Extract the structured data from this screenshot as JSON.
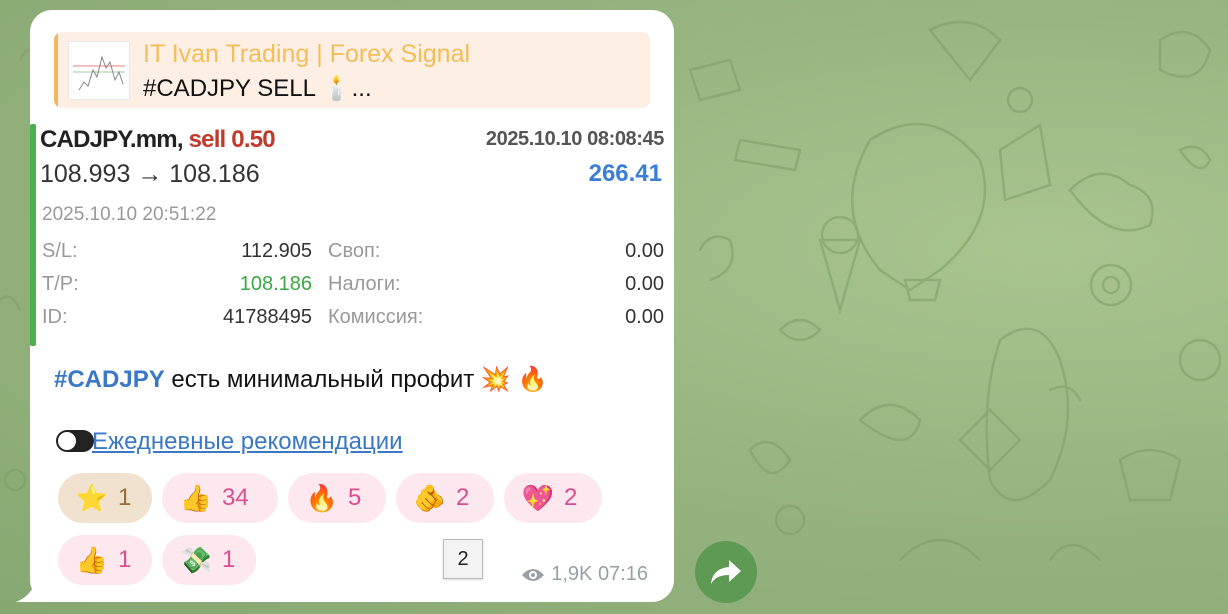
{
  "reply": {
    "channel": "IT Ivan Trading | Forex Signal",
    "preview": "#CADJPY SELL 🕯️..."
  },
  "trade": {
    "symbol": "CADJPY.mm,",
    "side": "sell 0.50",
    "open_time": "2025.10.10 08:08:45",
    "prices": "108.993 → 108.186",
    "profit": "266.41",
    "close_time": "2025.10.10 20:51:22",
    "sl_label": "S/L:",
    "sl_value": "112.905",
    "tp_label": "T/P:",
    "tp_value": "108.186",
    "id_label": "ID:",
    "id_value": "41788495",
    "swap_label": "Своп:",
    "swap_value": "0.00",
    "tax_label": "Налоги:",
    "tax_value": "0.00",
    "fee_label": "Комиссия:",
    "fee_value": "0.00"
  },
  "message": {
    "hashtag": "#CADJPY",
    "text": " есть минимальный профит ",
    "emoji": "💥 🔥",
    "link": "Ежедневные рекомендации"
  },
  "reactions": [
    {
      "icon": "⭐",
      "count": "1"
    },
    {
      "icon": "👍",
      "count": "34"
    },
    {
      "icon": "🔥",
      "count": "5"
    },
    {
      "icon": "🫵",
      "count": "2"
    },
    {
      "icon": "💖",
      "count": "2"
    },
    {
      "icon": "👍",
      "count": "1"
    },
    {
      "icon": "💸",
      "count": "1"
    }
  ],
  "meta": {
    "views": "1,9K",
    "time": "07:16"
  },
  "pager": "2",
  "colors": {
    "accent": "#3a78c5",
    "sell": "#c0392b",
    "profit": "#3a7fd5",
    "tp": "#3aa844",
    "reaction_count": "#d94f8e"
  }
}
